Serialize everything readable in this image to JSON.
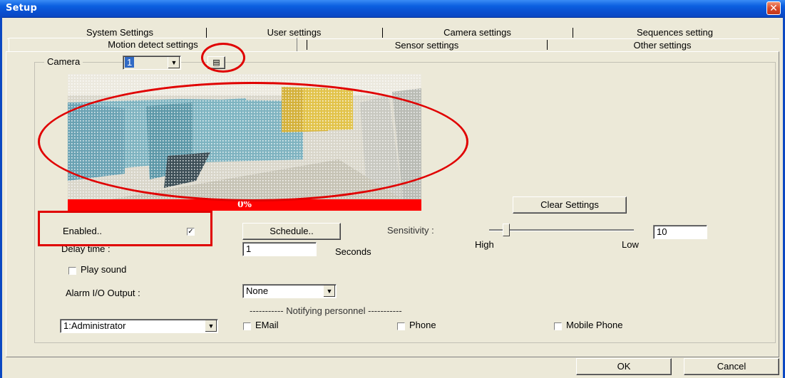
{
  "window": {
    "title": "Setup",
    "close_glyph": "✕"
  },
  "tabs": {
    "row1": [
      "System Settings",
      "User settings",
      "Camera settings",
      "Sequences setting"
    ],
    "row2": [
      "Motion detect settings",
      "Sensor settings",
      "Other settings"
    ],
    "active": "Motion detect settings"
  },
  "camera": {
    "label": "Camera",
    "selected": "1",
    "paste_glyph": "▤"
  },
  "preview": {
    "progress_text": "0%",
    "progress_value": 0
  },
  "motion": {
    "clear_label": "Clear Settings",
    "enabled_label": "Enabled..",
    "enabled_checked": true,
    "schedule_label": "Schedule..",
    "sensitivity_label": "Sensitivity :",
    "sensitivity_value": "10",
    "high_label": "High",
    "low_label": "Low",
    "delay_label": "Delay time :",
    "delay_value": "1",
    "seconds_label": "Seconds",
    "play_sound_label": "Play sound",
    "play_sound_checked": false,
    "alarm_label": "Alarm I/O Output :",
    "alarm_value": "None"
  },
  "notify": {
    "header": "----------- Notifying personnel -----------",
    "user_value": "1:Administrator",
    "email_label": "EMail",
    "phone_label": "Phone",
    "mobile_label": "Mobile Phone"
  },
  "footer": {
    "ok_label": "OK",
    "cancel_label": "Cancel"
  },
  "colors": {
    "titlebar": "#0b48c2",
    "dialog": "#ece9d8",
    "annotation": "#e00000",
    "progress": "#ff0000"
  },
  "icons": {
    "close": "close-icon",
    "paste": "paste-icon",
    "dropdown": "chevron-down-icon",
    "check": "check-icon"
  }
}
